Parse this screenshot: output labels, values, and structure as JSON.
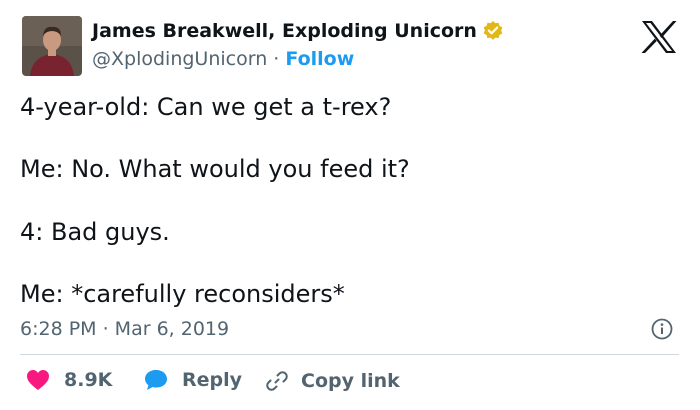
{
  "author": {
    "display_name": "James Breakwell, Exploding Unicorn",
    "handle": "@XplodingUnicorn",
    "separator": " · ",
    "follow_label": "Follow"
  },
  "tweet": {
    "lines": [
      "4-year-old: Can we get a t-rex?",
      "Me: No. What would you feed it?",
      "4: Bad guys.",
      "Me: *carefully reconsiders*"
    ],
    "timestamp": "6:28 PM · Mar 6, 2019"
  },
  "actions": {
    "like_count": "8.9K",
    "reply_label": "Reply",
    "copy_label": "Copy link"
  },
  "colors": {
    "link_blue": "#1d9bf0",
    "like_red": "#f91880",
    "secondary_text": "#536471",
    "verified_gold": "#e2b719"
  },
  "icons": [
    "verified-badge-icon",
    "x-logo-icon",
    "info-icon",
    "heart-icon",
    "reply-bubble-icon",
    "link-icon"
  ]
}
